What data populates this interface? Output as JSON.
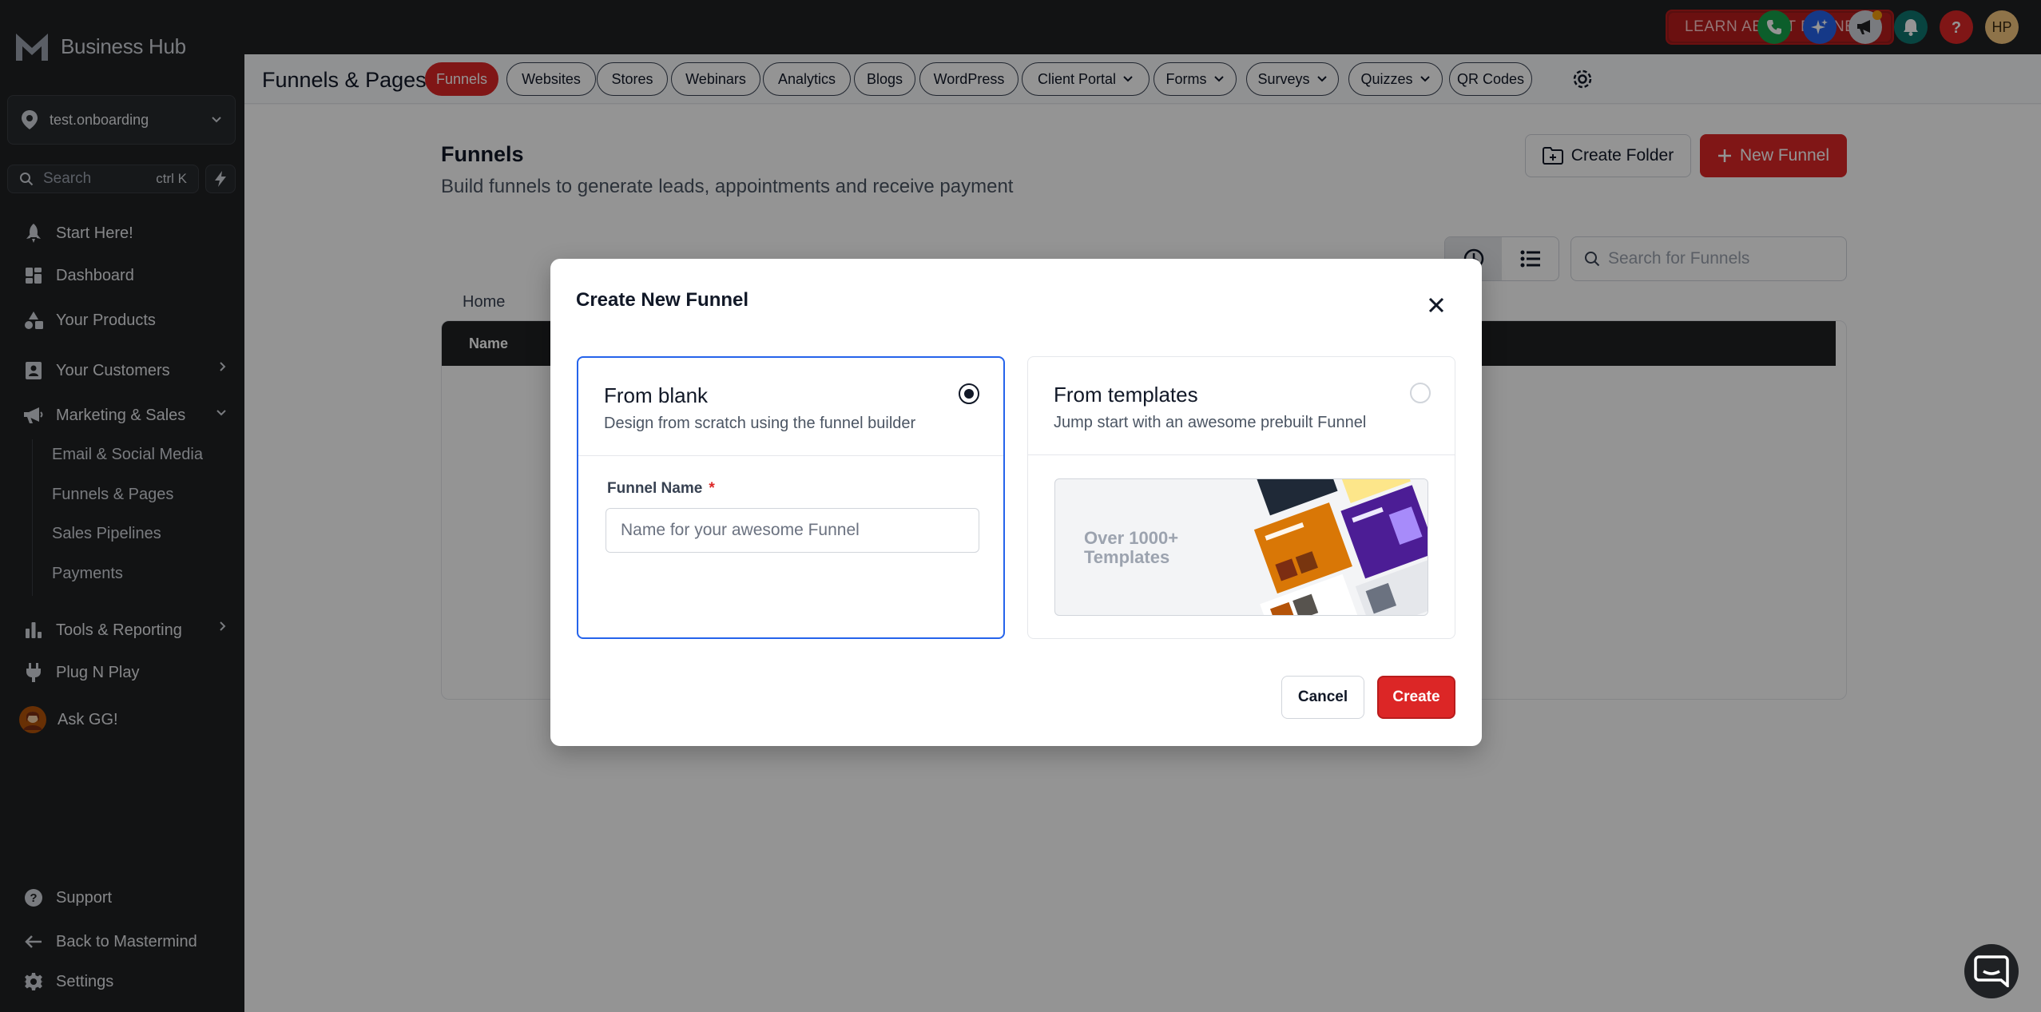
{
  "sidebar": {
    "brand": "Business Hub",
    "account": "test.onboarding",
    "search": {
      "label": "Search",
      "shortcut": "ctrl K"
    },
    "nav": [
      {
        "label": "Start Here!",
        "icon": "rocket-icon"
      },
      {
        "label": "Dashboard",
        "icon": "dashboard-icon"
      },
      {
        "label": "Your Products",
        "icon": "shapes-icon"
      },
      {
        "label": "Your Customers",
        "icon": "contacts-icon"
      },
      {
        "label": "Marketing & Sales",
        "icon": "megaphone-icon"
      },
      {
        "label": "Tools & Reporting",
        "icon": "bar-chart-icon"
      },
      {
        "label": "Plug N Play",
        "icon": "plug-icon"
      },
      {
        "label": "Ask GG!",
        "icon": "avatar-icon"
      }
    ],
    "sub_nav": [
      "Email & Social Media",
      "Funnels & Pages",
      "Sales Pipelines",
      "Payments"
    ],
    "footer": [
      {
        "label": "Support",
        "icon": "help-icon"
      },
      {
        "label": "Back to Mastermind",
        "icon": "arrow-left-icon"
      },
      {
        "label": "Settings",
        "icon": "gear-icon"
      }
    ]
  },
  "topbar": {
    "learn_button": "LEARN ABOUT FUNNELS",
    "avatar_initials": "HP",
    "colors": {
      "phone": "#16a34a",
      "ai": "#2563eb",
      "announce": "#d1d5db",
      "bell": "#0f766e",
      "help": "#dc2626",
      "avatar": "#f5c77e"
    }
  },
  "tabsbar": {
    "title": "Funnels & Pages",
    "tabs": [
      {
        "label": "Funnels",
        "active": true
      },
      {
        "label": "Websites"
      },
      {
        "label": "Stores"
      },
      {
        "label": "Webinars"
      },
      {
        "label": "Analytics"
      },
      {
        "label": "Blogs"
      },
      {
        "label": "WordPress"
      },
      {
        "label": "Client Portal",
        "dropdown": true
      },
      {
        "label": "Forms",
        "dropdown": true
      },
      {
        "label": "Surveys",
        "dropdown": true
      },
      {
        "label": "Quizzes",
        "dropdown": true
      },
      {
        "label": "QR Codes"
      }
    ]
  },
  "page": {
    "title": "Funnels",
    "subtitle": "Build funnels to generate leads, appointments and receive payment",
    "create_folder": "Create Folder",
    "new_funnel": "New Funnel",
    "search_placeholder": "Search for Funnels",
    "breadcrumb": "Home",
    "table_header_name": "Name"
  },
  "modal": {
    "title": "Create New Funnel",
    "blank": {
      "title": "From blank",
      "description": "Design from scratch using the funnel builder",
      "field_label": "Funnel Name",
      "required_mark": "*",
      "placeholder": "Name for your awesome Funnel",
      "value": ""
    },
    "templates": {
      "title": "From templates",
      "description": "Jump start with an awesome prebuilt Funnel",
      "preview_text": "Over 1000+ Templates"
    },
    "cancel": "Cancel",
    "create": "Create"
  },
  "colors": {
    "accent": "#dc2626",
    "selected_border": "#2563eb",
    "sidebar_bg": "#1f2124"
  }
}
